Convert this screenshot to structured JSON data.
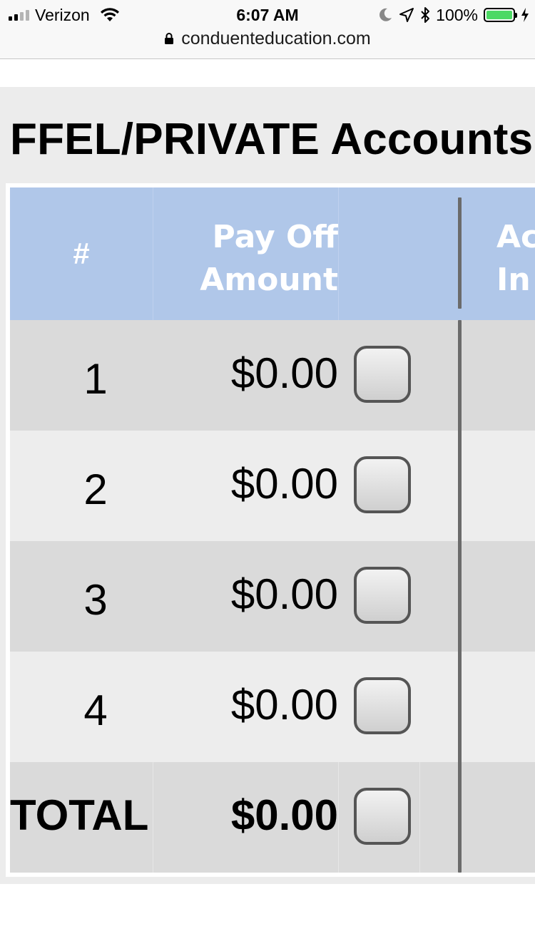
{
  "status_bar": {
    "carrier": "Verizon",
    "time": "6:07 AM",
    "battery": "100%",
    "url": "conduenteducation.com"
  },
  "page": {
    "heading": "FFEL/PRIVATE Accounts"
  },
  "table": {
    "headers": {
      "number": "#",
      "payoff_line1": "Pay Off",
      "payoff_line2": "Amount",
      "next_line1": "Ac",
      "next_line2": "In"
    },
    "rows": [
      {
        "number": "1",
        "amount": "$0.00"
      },
      {
        "number": "2",
        "amount": "$0.00"
      },
      {
        "number": "3",
        "amount": "$0.00"
      },
      {
        "number": "4",
        "amount": "$0.00"
      }
    ],
    "total": {
      "label": "TOTAL",
      "amount": "$0.00"
    }
  },
  "colors": {
    "header_bg": "#b0c7e9",
    "row_dark": "#dadada",
    "row_light": "#ededed",
    "battery_green": "#4cd964"
  },
  "icons": [
    "signal-icon",
    "wifi-icon",
    "moon-icon",
    "location-arrow-icon",
    "bluetooth-icon",
    "battery-icon",
    "charging-bolt-icon",
    "lock-icon"
  ]
}
